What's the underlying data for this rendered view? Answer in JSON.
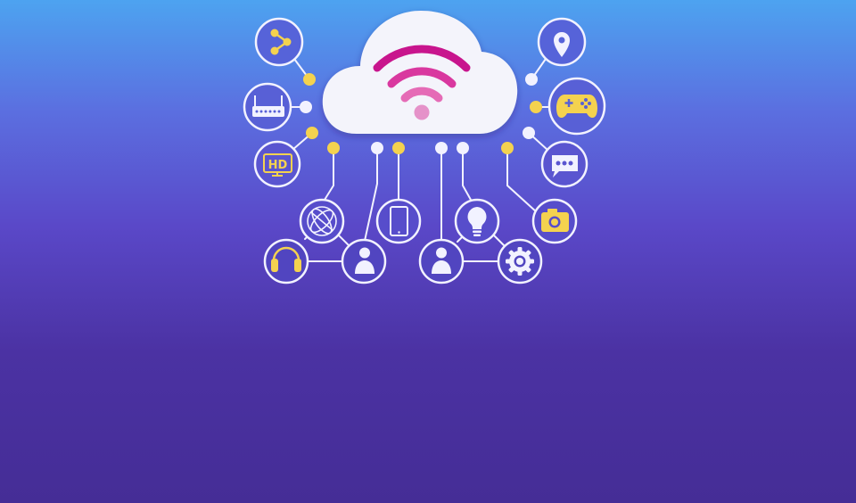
{
  "colors": {
    "wifi_outer": "#c8158d",
    "wifi_mid": "#d9389f",
    "wifi_inner": "#e56bb6",
    "wifi_dot": "#e592c9",
    "accent_yellow": "#f4d24f",
    "line_white": "#f2f2ff",
    "cloud_fill": "#f4f4fb"
  },
  "icons": [
    "share-icon",
    "router-icon",
    "hd-tv-icon",
    "location-pin-icon",
    "gamepad-icon",
    "chat-bubble-icon",
    "camera-icon",
    "globe-icon",
    "tablet-icon",
    "lightbulb-icon",
    "headphones-icon",
    "user-icon",
    "gear-icon"
  ],
  "hd_label": "HD"
}
